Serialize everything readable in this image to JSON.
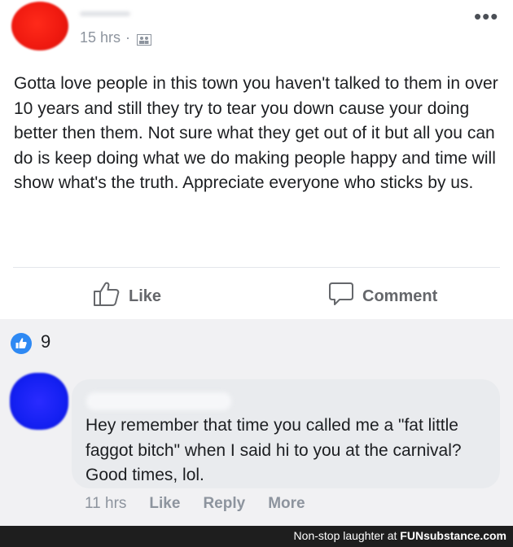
{
  "post": {
    "timestamp": "15 hrs",
    "separator": "·",
    "privacy_icon": "friends-icon",
    "more_icon": "more-dots-icon",
    "more_label": "•••",
    "text": "Gotta love people in this town you haven't talked to them in over 10 years and still they try to tear you down cause your doing better then them. Not sure what they get out of it but all you can do is keep doing what we do making people happy and time will show what's the truth. Appreciate everyone who sticks by us.",
    "actions": {
      "like_label": "Like",
      "comment_label": "Comment"
    }
  },
  "reactions": {
    "icon": "like-thumb-icon",
    "count": "9",
    "color": "#2e89f3"
  },
  "comment": {
    "text": "Hey remember that time you called me a \"fat little faggot bitch\" when I said hi to you at the carnival? Good times, lol.",
    "timestamp": "11 hrs",
    "like_label": "Like",
    "reply_label": "Reply",
    "more_label": "More"
  },
  "watermark": {
    "caption": "Non-stop laughter at",
    "brand": "FUNsubstance.com"
  },
  "colors": {
    "avatar_redacted_post": "#f01a10",
    "avatar_redacted_comment": "#1420f2",
    "muted_text": "#8d949e"
  }
}
